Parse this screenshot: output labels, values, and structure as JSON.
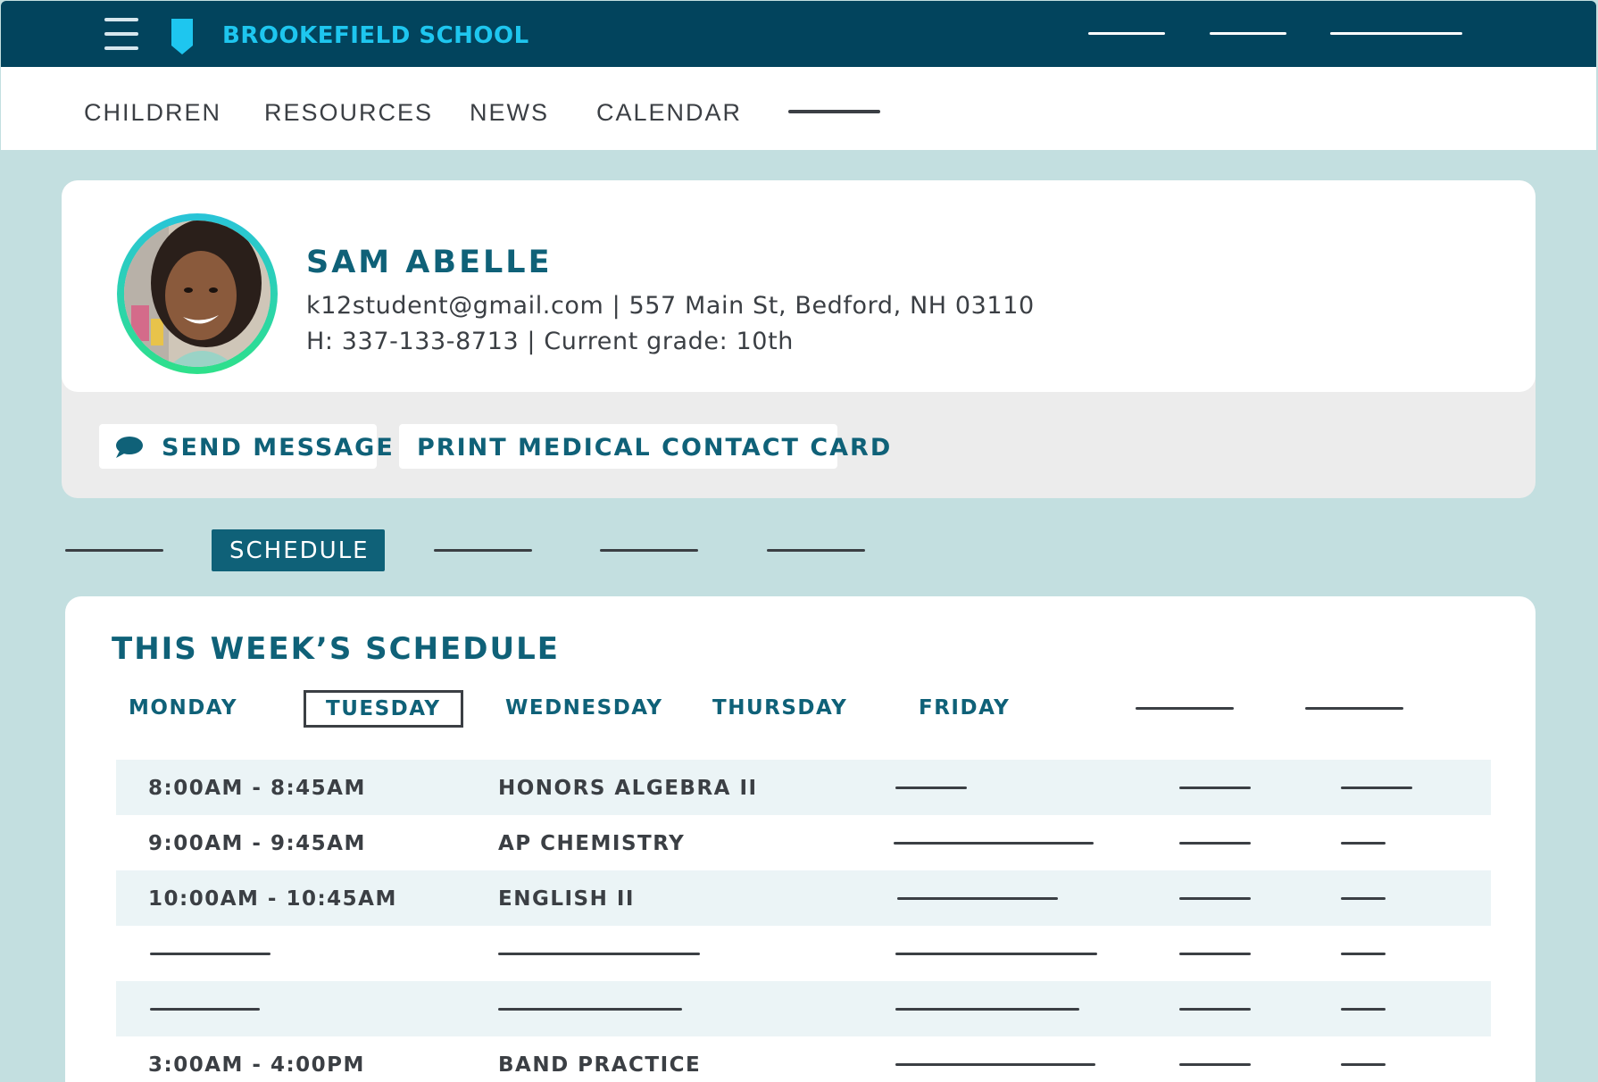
{
  "header": {
    "school_name": "BROOKEFIELD SCHOOL",
    "brand_color": "#02445d",
    "accent_color": "#1ec6ef"
  },
  "nav": {
    "items": [
      "CHILDREN",
      "RESOURCES",
      "NEWS",
      "CALENDAR"
    ]
  },
  "student": {
    "name": "SAM ABELLE",
    "contact_line": "k12student@gmail.com | 557 Main St, Bedford, NH 03110",
    "phone_grade_line": "H: 337-133-8713 | Current grade: 10th"
  },
  "actions": {
    "send_message": "SEND MESSAGE",
    "print_card": "PRINT MEDICAL CONTACT CARD"
  },
  "tabs": {
    "active": "SCHEDULE"
  },
  "schedule": {
    "title": "THIS WEEK’S SCHEDULE",
    "days": [
      "MONDAY",
      "TUESDAY",
      "WEDNESDAY",
      "THURSDAY",
      "FRIDAY"
    ],
    "selected_day": "TUESDAY",
    "rows": [
      {
        "time": "8:00AM - 8:45AM",
        "subject": "HONORS ALGEBRA II"
      },
      {
        "time": "9:00AM - 9:45AM",
        "subject": "AP CHEMISTRY"
      },
      {
        "time": "10:00AM - 10:45AM",
        "subject": "ENGLISH II"
      },
      {
        "time": "",
        "subject": ""
      },
      {
        "time": "",
        "subject": ""
      },
      {
        "time": "3:00AM - 4:00PM",
        "subject": "BAND PRACTICE"
      }
    ]
  }
}
